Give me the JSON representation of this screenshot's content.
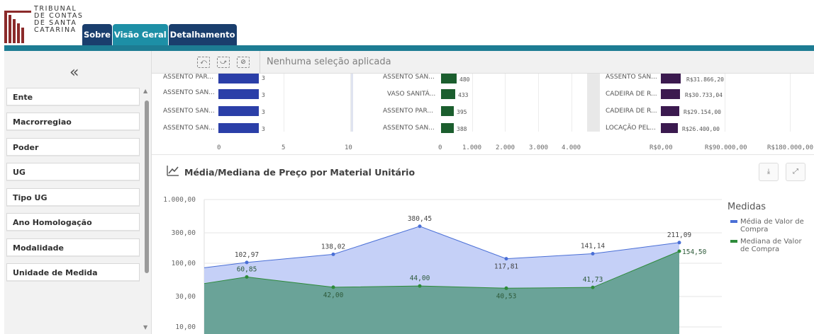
{
  "logo": {
    "lines": [
      "TRIBUNAL",
      "DE CONTAS",
      "DE SANTA",
      "CATARINA"
    ]
  },
  "tabs": [
    {
      "label": "Sobre"
    },
    {
      "label": "Visão Geral"
    },
    {
      "label": "Detalhamento"
    }
  ],
  "sidebar": {
    "collapse_glyph": "«",
    "filters": [
      "Ente",
      "Macrorregiao",
      "Poder",
      "UG",
      "Tipo UG",
      "Ano Homologação",
      "Modalidade",
      "Unidade de Medida"
    ]
  },
  "selection_bar": {
    "text": "Nenhuma seleção aplicada"
  },
  "top_charts": {
    "chart1": {
      "rows": [
        {
          "label": "ASSENTO PAR...",
          "value": "3"
        },
        {
          "label": "ASSENTO SAN...",
          "value": "3"
        },
        {
          "label": "ASSENTO SAN...",
          "value": "3"
        },
        {
          "label": "ASSENTO SAN...",
          "value": "3"
        }
      ],
      "ticks": [
        "0",
        "5",
        "10"
      ],
      "color": "#2b3fa8"
    },
    "chart2": {
      "rows": [
        {
          "label": "ASSENTO SAN...",
          "value": "480"
        },
        {
          "label": "VASO SANITÁ...",
          "value": "433"
        },
        {
          "label": "ASSENTO PAR...",
          "value": "395"
        },
        {
          "label": "ASSENTO SAN...",
          "value": "388"
        }
      ],
      "ticks": [
        "0",
        "1.000",
        "2.000",
        "3.000",
        "4.000"
      ],
      "color": "#1b5e2e"
    },
    "chart3": {
      "rows": [
        {
          "label": "ASSENTO SAN...",
          "value": "R$31.866,20"
        },
        {
          "label": "CADEIRA DE R...",
          "value": "R$30.733,04"
        },
        {
          "label": "CADEIRA DE R...",
          "value": "R$29.154,00"
        },
        {
          "label": "LOCAÇÃO PEL...",
          "value": "R$26.400,00"
        }
      ],
      "ticks": [
        "R$0,00",
        "R$90.000,00",
        "R$180.000,00"
      ],
      "color": "#3b1a4f"
    }
  },
  "line_chart_title": "Média/Mediana de Preço por Material Unitário",
  "chart_data": {
    "type": "area",
    "title": "Média/Mediana de Preço por Material Unitário",
    "y_scale": "log",
    "ylim": [
      10,
      1000
    ],
    "y_ticks": [
      "1.000,00",
      "300,00",
      "100,00",
      "30,00",
      "10,00"
    ],
    "y_tick_values": [
      1000,
      300,
      100,
      30,
      10
    ],
    "legend_title": "Medidas",
    "legend_position": "right",
    "series": [
      {
        "name": "Média de Valor de Compra",
        "color": "#4a6fd6",
        "fill": "#c5d0f7",
        "values": [
          85,
          102.97,
          138.02,
          380.45,
          117.81,
          141.14,
          211.09
        ],
        "labels": [
          "",
          "102,97",
          "138,02",
          "380,45",
          "117,81",
          "141,14",
          "211,09"
        ]
      },
      {
        "name": "Mediana de Valor de Compra",
        "color": "#2e8b3a",
        "fill": "#6aa398",
        "values": [
          48,
          60.85,
          42.0,
          44.0,
          40.53,
          41.73,
          154.5
        ],
        "labels": [
          "",
          "60,85",
          "42,00",
          "44,00",
          "40,53",
          "41,73",
          "154,50"
        ]
      }
    ]
  }
}
